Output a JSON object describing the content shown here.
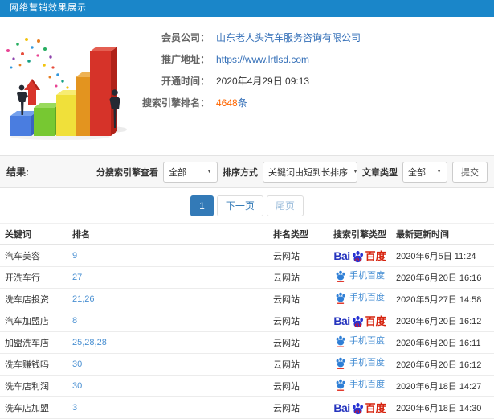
{
  "header": {
    "title": "网络营销效果展示"
  },
  "info": {
    "rows": [
      {
        "label": "会员公司：",
        "value": "山东老人头汽车服务咨询有限公司"
      },
      {
        "label": "推广地址：",
        "value": "https://www.lrtlsd.com"
      },
      {
        "label": "开通时间：",
        "value": "2020年4月29日 09:13"
      },
      {
        "label": "搜索引擎排名：",
        "count": "4648",
        "unit": "条"
      }
    ]
  },
  "filters": {
    "result_label": "结果:",
    "engine_label": "分搜索引擎查看",
    "engine_value": "全部",
    "sort_label": "排序方式",
    "sort_value": "关键词由短到长排序",
    "type_label": "文章类型",
    "type_value": "全部",
    "submit_label": "提交",
    "caret": "▼"
  },
  "pagination": {
    "current": "1",
    "next": "下一页",
    "last": "尾页"
  },
  "table": {
    "headers": [
      "关键词",
      "排名",
      "排名类型",
      "搜索引擎类型",
      "最新更新时间"
    ],
    "rows": [
      {
        "keyword": "汽车美容",
        "rank": "9",
        "rank_type": "云网站",
        "engine": "baidu",
        "time": "2020年6月5日 11:24"
      },
      {
        "keyword": "开洗车行",
        "rank": "27",
        "rank_type": "云网站",
        "engine": "mobile",
        "time": "2020年6月20日 16:16"
      },
      {
        "keyword": "洗车店投资",
        "rank": "21,26",
        "rank_type": "云网站",
        "engine": "mobile",
        "time": "2020年5月27日 14:58"
      },
      {
        "keyword": "汽车加盟店",
        "rank": "8",
        "rank_type": "云网站",
        "engine": "baidu",
        "time": "2020年6月20日 16:12"
      },
      {
        "keyword": "加盟洗车店",
        "rank": "25,28,28",
        "rank_type": "云网站",
        "engine": "mobile",
        "time": "2020年6月20日 16:11"
      },
      {
        "keyword": "洗车赚钱吗",
        "rank": "30",
        "rank_type": "云网站",
        "engine": "mobile",
        "time": "2020年6月20日 16:12"
      },
      {
        "keyword": "洗车店利润",
        "rank": "30",
        "rank_type": "云网站",
        "engine": "mobile",
        "time": "2020年6月18日 14:27"
      },
      {
        "keyword": "洗车店加盟",
        "rank": "3",
        "rank_type": "云网站",
        "engine": "baidu",
        "time": "2020年6月18日 14:30"
      }
    ]
  },
  "logos": {
    "baidu_bai": "Bai",
    "baidu_du": "du",
    "baidu_cn": "百度",
    "mobile_label": "手机百度"
  },
  "colors": {
    "topbar": "#1a86c9",
    "link": "#3570b8",
    "rank": "#4a90d2",
    "highlight": "#ff6600",
    "active_page": "#337ab7"
  }
}
